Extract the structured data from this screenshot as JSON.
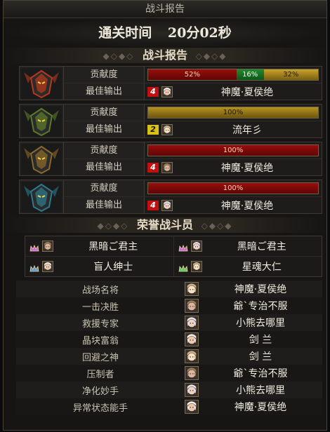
{
  "window": {
    "title": "战斗报告"
  },
  "clear_time": {
    "label": "通关时间",
    "value": "20分02秒"
  },
  "section_battle": {
    "title": "战斗报告"
  },
  "bosses": [
    {
      "contrib_label": "贡献度",
      "best_label": "最佳输出",
      "contributions": [
        {
          "text": "52%",
          "percent": 52,
          "color": "red"
        },
        {
          "text": "16%",
          "percent": 16,
          "color": "green"
        },
        {
          "text": "32%",
          "percent": 32,
          "color": "gold"
        }
      ],
      "rank": "4",
      "rank_color": "red",
      "best_name": "神魔·夏侯绝",
      "portrait_color": "#b53a1c"
    },
    {
      "contrib_label": "贡献度",
      "best_label": "最佳输出",
      "contributions": [
        {
          "text": "100%",
          "percent": 100,
          "color": "gold-dark"
        }
      ],
      "rank": "2",
      "rank_color": "yellow",
      "best_name": "流年彡",
      "portrait_color": "#5c7a2a"
    },
    {
      "contrib_label": "贡献度",
      "best_label": "最佳输出",
      "contributions": [
        {
          "text": "100%",
          "percent": 100,
          "color": "red"
        }
      ],
      "rank": "4",
      "rank_color": "red",
      "best_name": "神魔·夏侯绝",
      "portrait_color": "#8a6a2a"
    },
    {
      "contrib_label": "贡献度",
      "best_label": "最佳输出",
      "contributions": [
        {
          "text": "100%",
          "percent": 100,
          "color": "red"
        }
      ],
      "rank": "4",
      "rank_color": "red",
      "best_name": "神魔·夏侯绝",
      "portrait_color": "#2c7a8e"
    }
  ],
  "section_honor": {
    "title": "荣誉战斗员"
  },
  "honor": [
    [
      "黑暗ご君主",
      "黑暗ご君主"
    ],
    [
      "盲人绅士",
      "星魂大仁"
    ]
  ],
  "awards": [
    {
      "title": "战场名将",
      "name": "神魔·夏侯绝"
    },
    {
      "title": "一击决胜",
      "name": "爺`专治不服"
    },
    {
      "title": "救援专家",
      "name": "小熊去哪里"
    },
    {
      "title": "晶块富翁",
      "name": "剑 兰"
    },
    {
      "title": "回避之神",
      "name": "剑 兰"
    },
    {
      "title": "压制者",
      "name": "爺`专治不服"
    },
    {
      "title": "净化妙手",
      "name": "小熊去哪里"
    },
    {
      "title": "异常状态能手",
      "name": "神魔·夏侯绝"
    }
  ]
}
